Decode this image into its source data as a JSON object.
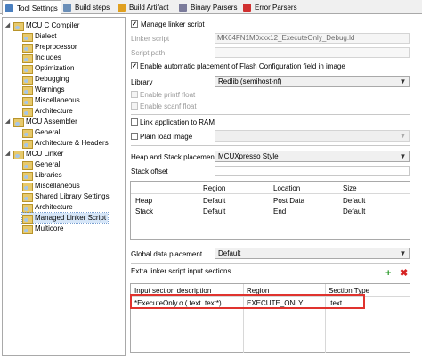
{
  "tabs": [
    {
      "label": "Tool Settings",
      "icon": "tool-settings-icon",
      "color": "#4a7fbf",
      "active": true
    },
    {
      "label": "Build steps",
      "icon": "build-steps-icon",
      "color": "#6b8fb8"
    },
    {
      "label": "Build Artifact",
      "icon": "build-artifact-icon",
      "color": "#e0a020"
    },
    {
      "label": "Binary Parsers",
      "icon": "binary-parsers-icon",
      "color": "#7a7a9a"
    },
    {
      "label": "Error Parsers",
      "icon": "error-parsers-icon",
      "color": "#d03030"
    }
  ],
  "tree": {
    "items": [
      {
        "label": "MCU C Compiler",
        "level": 0,
        "expanded": true
      },
      {
        "label": "Dialect",
        "level": 1
      },
      {
        "label": "Preprocessor",
        "level": 1
      },
      {
        "label": "Includes",
        "level": 1
      },
      {
        "label": "Optimization",
        "level": 1
      },
      {
        "label": "Debugging",
        "level": 1
      },
      {
        "label": "Warnings",
        "level": 1
      },
      {
        "label": "Miscellaneous",
        "level": 1
      },
      {
        "label": "Architecture",
        "level": 1
      },
      {
        "label": "MCU Assembler",
        "level": 0,
        "expanded": true
      },
      {
        "label": "General",
        "level": 1
      },
      {
        "label": "Architecture & Headers",
        "level": 1
      },
      {
        "label": "MCU Linker",
        "level": 0,
        "expanded": true
      },
      {
        "label": "General",
        "level": 1
      },
      {
        "label": "Libraries",
        "level": 1
      },
      {
        "label": "Miscellaneous",
        "level": 1
      },
      {
        "label": "Shared Library Settings",
        "level": 1
      },
      {
        "label": "Architecture",
        "level": 1
      },
      {
        "label": "Managed Linker Script",
        "level": 1,
        "selected": true
      },
      {
        "label": "Multicore",
        "level": 1
      }
    ]
  },
  "settings": {
    "manage_linker_script": {
      "label": "Manage linker script",
      "checked": true
    },
    "linker_script": {
      "label": "Linker script",
      "value": "MK64FN1M0xxx12_ExecuteOnly_Debug.ld"
    },
    "script_path": {
      "label": "Script path",
      "value": ""
    },
    "enable_flash_config": {
      "label": "Enable automatic placement of Flash Configuration field in image",
      "checked": true
    },
    "library": {
      "label": "Library",
      "value": "Redlib (semihost-nf)"
    },
    "enable_printf_float": {
      "label": "Enable printf float",
      "checked": false
    },
    "enable_scanf_float": {
      "label": "Enable scanf float",
      "checked": false
    },
    "link_to_ram": {
      "label": "Link application to RAM",
      "checked": false
    },
    "plain_load_image": {
      "label": "Plain load image",
      "checked": false
    },
    "heap_stack_placement": {
      "label": "Heap and Stack placement",
      "value": "MCUXpresso Style"
    },
    "stack_offset": {
      "label": "Stack offset",
      "value": ""
    },
    "heap_stack_table": {
      "headers": [
        "",
        "Region",
        "Location",
        "Size"
      ],
      "rows": [
        [
          "Heap",
          "Default",
          "Post Data",
          "Default"
        ],
        [
          "Stack",
          "Default",
          "End",
          "Default"
        ]
      ]
    },
    "global_data_placement": {
      "label": "Global data placement",
      "value": "Default"
    },
    "extra_sections": {
      "label": "Extra linker script input sections",
      "add_icon": "add-icon",
      "remove_icon": "remove-icon",
      "headers": [
        "Input section description",
        "Region",
        "Section Type"
      ],
      "rows": [
        [
          "*ExecuteOnly.o (.text .text*)",
          "EXECUTE_ONLY",
          ".text"
        ]
      ],
      "highlight_color": "#e0332e"
    }
  }
}
